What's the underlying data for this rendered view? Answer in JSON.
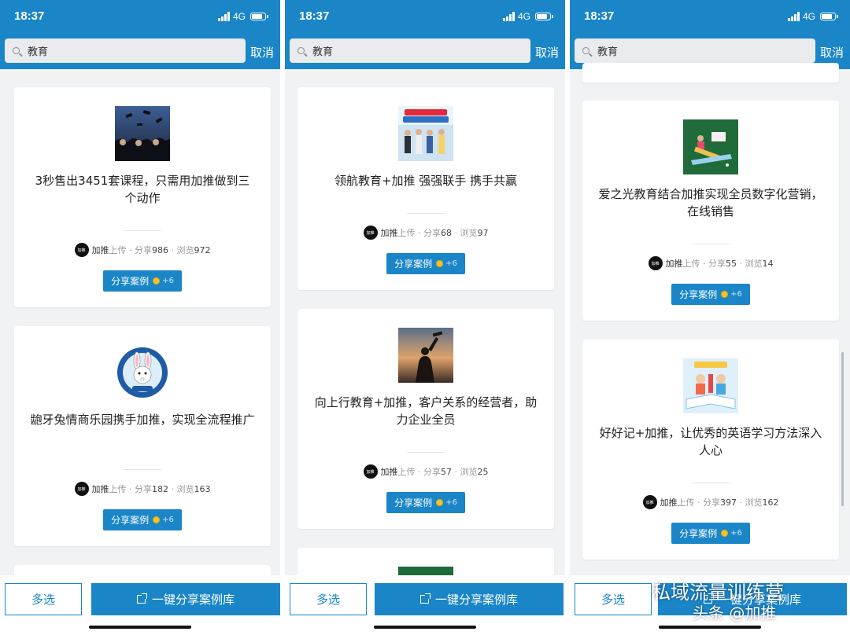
{
  "status": {
    "time": "18:37",
    "network": "4G"
  },
  "search": {
    "query": "教育",
    "cancel": "取消"
  },
  "screens": [
    {
      "cards": [
        {
          "title": "3秒售出3451套课程，只需用加推做到三个动作",
          "uploader": "加推",
          "upload_label": "上传",
          "share_label": "分享",
          "share_count": "986",
          "view_label": "浏览",
          "view_count": "972",
          "logo_text": "加推"
        },
        {
          "title": "龅牙兔情商乐园携手加推，实现全流程推广",
          "uploader": "加推",
          "upload_label": "上传",
          "share_label": "分享",
          "share_count": "182",
          "view_label": "浏览",
          "view_count": "163",
          "logo_text": "加推"
        }
      ]
    },
    {
      "cards": [
        {
          "title": "领航教育+加推 强强联手 携手共赢",
          "uploader": "加推",
          "upload_label": "上传",
          "share_label": "分享",
          "share_count": "68",
          "view_label": "浏览",
          "view_count": "97",
          "logo_text": "加推"
        },
        {
          "title": "向上行教育+加推，客户关系的经营者，助力企业全员",
          "uploader": "加推",
          "upload_label": "上传",
          "share_label": "分享",
          "share_count": "57",
          "view_label": "浏览",
          "view_count": "25",
          "logo_text": "加推"
        }
      ]
    },
    {
      "cards": [
        {
          "title": "爱之光教育结合加推实现全员数字化营销，在线销售",
          "uploader": "加推",
          "upload_label": "上传",
          "share_label": "分享",
          "share_count": "55",
          "view_label": "浏览",
          "view_count": "14",
          "logo_text": "加推"
        },
        {
          "title": "好好记+加推，让优秀的英语学习方法深入人心",
          "uploader": "加推",
          "upload_label": "上传",
          "share_label": "分享",
          "share_count": "397",
          "view_label": "浏览",
          "view_count": "162",
          "logo_text": "加推"
        }
      ]
    }
  ],
  "share_button": {
    "label": "分享案例",
    "reward": "+6"
  },
  "bottom": {
    "multi_select": "多选",
    "share_library": "一键分享案例库"
  },
  "watermark": {
    "line1": "私域流量训练营",
    "line2": "头条 @加推"
  },
  "colors": {
    "primary": "#1a86c8",
    "background": "#f1f2f4",
    "coin": "#f2c230"
  }
}
